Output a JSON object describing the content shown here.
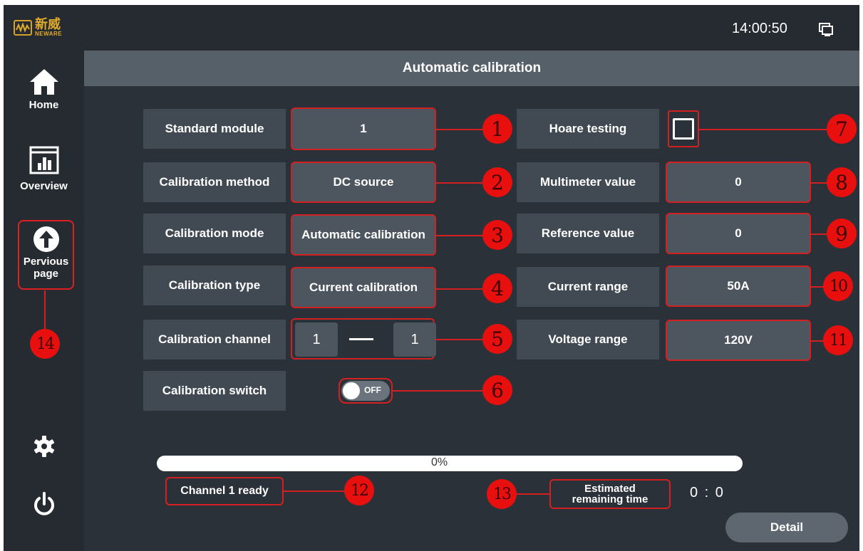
{
  "app": {
    "logo_cn": "新威",
    "logo_en": "NEWARE",
    "clock": "14:00:50"
  },
  "sidebar": {
    "home": "Home",
    "overview": "Overview",
    "previous": "Pervious page",
    "previous_line1": "Pervious",
    "previous_line2": "page"
  },
  "title": "Automatic calibration",
  "left_fields": [
    {
      "label": "Standard module",
      "value": "1"
    },
    {
      "label": "Calibration method",
      "value": "DC source"
    },
    {
      "label": "Calibration mode",
      "value": "Automatic calibration"
    },
    {
      "label": "Calibration type",
      "value": "Current calibration"
    },
    {
      "label": "Calibration channel",
      "from": "1",
      "to": "1"
    },
    {
      "label": "Calibration switch",
      "toggle": "OFF"
    }
  ],
  "right_fields": [
    {
      "label": "Hoare  testing",
      "checked": false
    },
    {
      "label": "Multimeter value",
      "value": "0"
    },
    {
      "label": "Reference value",
      "value": "0"
    },
    {
      "label": "Current range",
      "value": "50A"
    },
    {
      "label": "Voltage range",
      "value": "120V"
    }
  ],
  "markers": [
    "1",
    "2",
    "3",
    "4",
    "5",
    "6",
    "7",
    "8",
    "9",
    "10",
    "11",
    "12",
    "13",
    "14"
  ],
  "progress": {
    "percent": 0,
    "text": "0%"
  },
  "status": "Channel 1 ready",
  "estimated_label": "Estimated remaining time",
  "estimated_line1": "Estimated",
  "estimated_line2": "remaining time",
  "estimated_value": "0 : 0",
  "detail_button": "Detail",
  "colors": {
    "annotation": "#d42020",
    "marker": "#e8100f",
    "logo": "#e0aa2c"
  }
}
